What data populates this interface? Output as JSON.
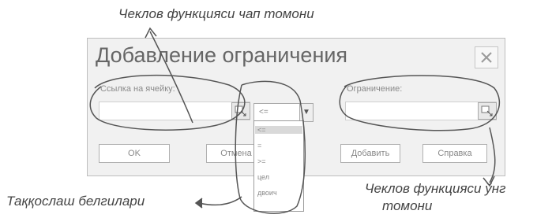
{
  "annotations": {
    "top": "Чеклов функцияси чап томони",
    "left_bottom": "Таққослаш белгилари",
    "right_bottom_line1": "Чеклов функцияси ўнг",
    "right_bottom_line2": "томони"
  },
  "dialog": {
    "title": "Добавление ограничения",
    "cell_ref_label": "Ссылка на ячейку:",
    "constraint_label": "Ограничение:",
    "operator_value": "<=",
    "operator_options": [
      "<=",
      "=",
      ">=",
      "цел",
      "двоич"
    ],
    "buttons": {
      "ok": "OK",
      "cancel": "Отмена",
      "add": "Добавить",
      "help": "Справка"
    }
  }
}
